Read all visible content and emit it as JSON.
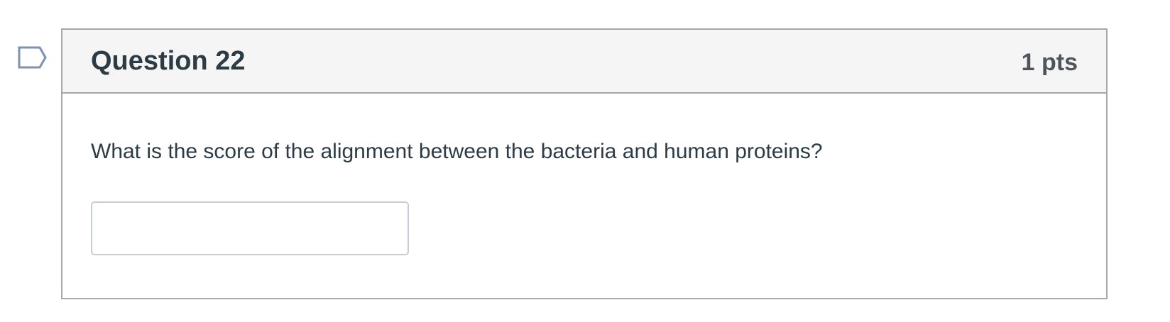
{
  "question": {
    "title": "Question 22",
    "points": "1 pts",
    "text": "What is the score of the alignment between the bacteria and human proteins?",
    "answer": {
      "value": "",
      "placeholder": ""
    },
    "flag_icon": "bookmark-flag-icon"
  },
  "colors": {
    "header_bg": "#f5f5f5",
    "border": "#a6a9ab",
    "text": "#2d3b45",
    "flag": "#7b93ae"
  }
}
